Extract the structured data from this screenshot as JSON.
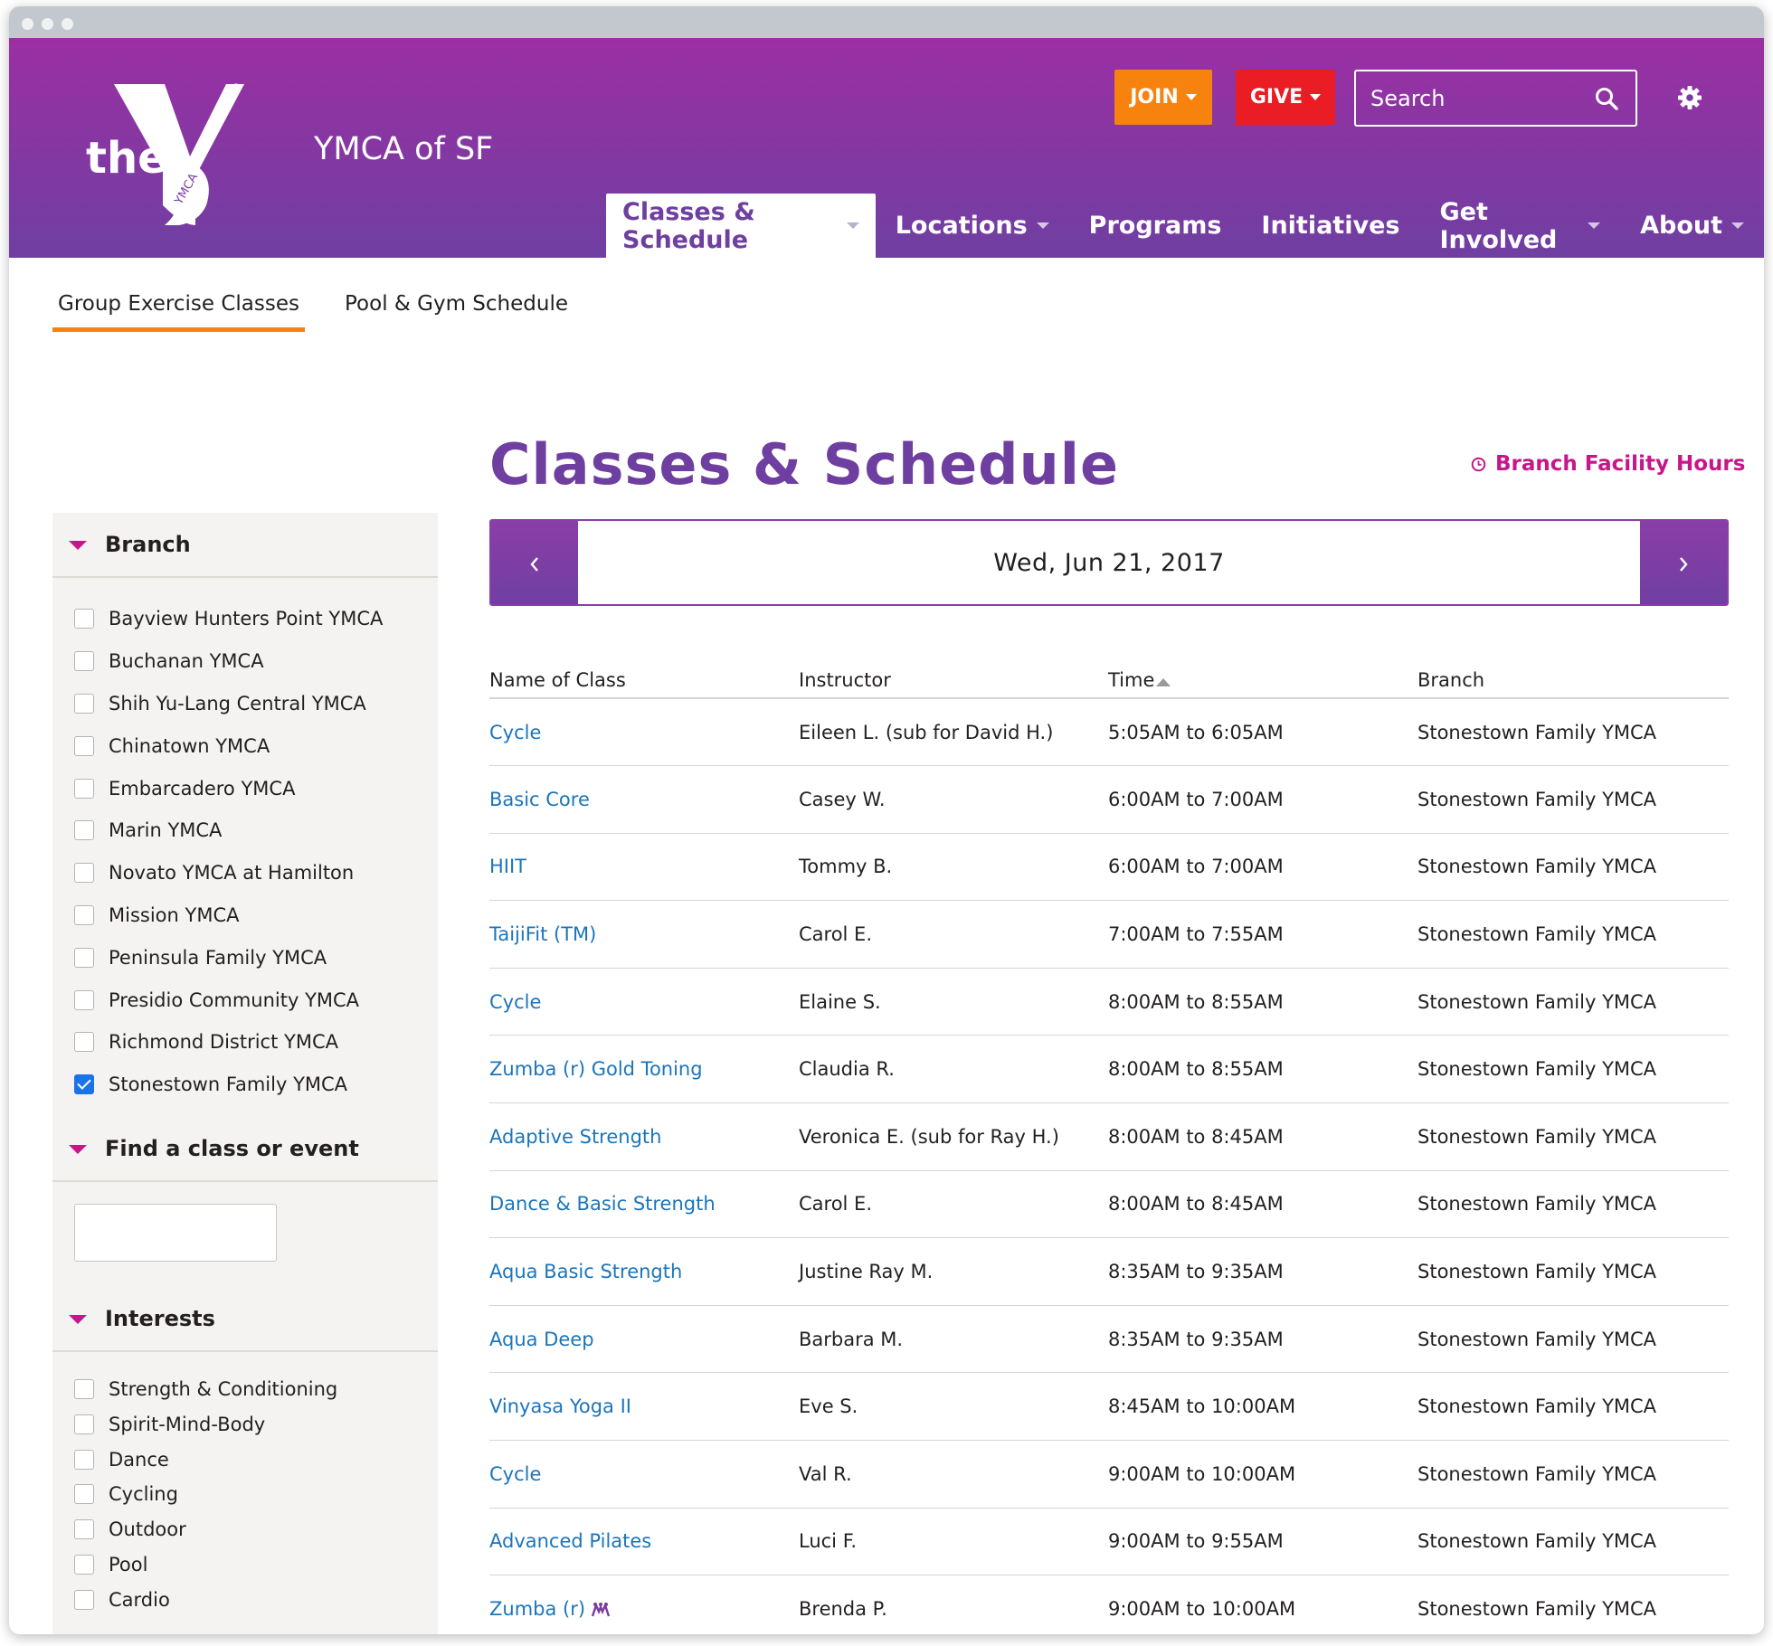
{
  "header": {
    "logo_text": "the",
    "logo_mark": "YMCA",
    "site_name": "YMCA of SF",
    "join_label": "JOIN",
    "give_label": "GIVE",
    "search_placeholder": "Search",
    "brand_gradient": [
      "#9b2fa3",
      "#6f3fa2"
    ],
    "join_color": "#f7820e",
    "give_color": "#ea1c24"
  },
  "nav": [
    {
      "label": "Classes & Schedule",
      "active": true,
      "dropdown": true
    },
    {
      "label": "Locations",
      "dropdown": true
    },
    {
      "label": "Programs",
      "dropdown": false
    },
    {
      "label": "Initiatives",
      "dropdown": false
    },
    {
      "label": "Get Involved",
      "dropdown": true
    },
    {
      "label": "About",
      "dropdown": true
    }
  ],
  "subnav": {
    "tabs": [
      "Group Exercise Classes",
      "Pool & Gym Schedule"
    ],
    "active": "Group Exercise Classes"
  },
  "page": {
    "title": "Classes & Schedule",
    "facility_link": "Branch Facility Hours",
    "date": "Wed, Jun 21, 2017"
  },
  "filters": {
    "branch": {
      "heading": "Branch",
      "items": [
        {
          "label": "Bayview Hunters Point YMCA",
          "checked": false
        },
        {
          "label": "Buchanan YMCA",
          "checked": false
        },
        {
          "label": "Shih Yu-Lang Central YMCA",
          "checked": false
        },
        {
          "label": "Chinatown YMCA",
          "checked": false
        },
        {
          "label": "Embarcadero YMCA",
          "checked": false
        },
        {
          "label": "Marin YMCA",
          "checked": false
        },
        {
          "label": "Novato YMCA at Hamilton",
          "checked": false
        },
        {
          "label": "Mission YMCA",
          "checked": false
        },
        {
          "label": "Peninsula Family YMCA",
          "checked": false
        },
        {
          "label": "Presidio Community YMCA",
          "checked": false
        },
        {
          "label": "Richmond District YMCA",
          "checked": false
        },
        {
          "label": "Stonestown Family YMCA",
          "checked": true
        }
      ]
    },
    "find": {
      "heading": "Find a class or event",
      "value": ""
    },
    "interests": {
      "heading": "Interests",
      "items": [
        {
          "label": "Strength & Conditioning",
          "checked": false
        },
        {
          "label": "Spirit-Mind-Body",
          "checked": false
        },
        {
          "label": "Dance",
          "checked": false
        },
        {
          "label": "Cycling",
          "checked": false
        },
        {
          "label": "Outdoor",
          "checked": false
        },
        {
          "label": "Pool",
          "checked": false
        },
        {
          "label": "Cardio",
          "checked": false
        }
      ]
    }
  },
  "table": {
    "columns": [
      "Name of Class",
      "Instructor",
      "Time",
      "Branch"
    ],
    "sorted_by": "Time",
    "rows": [
      {
        "name": "Cycle",
        "instructor": "Eileen L. (sub for David H.)",
        "time": "5:05AM to 6:05AM",
        "branch": "Stonestown Family YMCA"
      },
      {
        "name": "Basic Core",
        "instructor": "Casey W.",
        "time": "6:00AM to 7:00AM",
        "branch": "Stonestown Family YMCA"
      },
      {
        "name": "HIIT",
        "instructor": "Tommy B.",
        "time": "6:00AM to 7:00AM",
        "branch": "Stonestown Family YMCA"
      },
      {
        "name": "TaijiFit (TM)",
        "instructor": "Carol E.",
        "time": "7:00AM to 7:55AM",
        "branch": "Stonestown Family YMCA"
      },
      {
        "name": "Cycle",
        "instructor": "Elaine S.",
        "time": "8:00AM to 8:55AM",
        "branch": "Stonestown Family YMCA"
      },
      {
        "name": "Zumba (r) Gold Toning",
        "instructor": "Claudia R.",
        "time": "8:00AM to 8:55AM",
        "branch": "Stonestown Family YMCA"
      },
      {
        "name": "Adaptive Strength",
        "instructor": "Veronica E. (sub for Ray H.)",
        "time": "8:00AM to 8:45AM",
        "branch": "Stonestown Family YMCA"
      },
      {
        "name": "Dance & Basic Strength",
        "instructor": "Carol E.",
        "time": "8:00AM to 8:45AM",
        "branch": "Stonestown Family YMCA"
      },
      {
        "name": "Aqua Basic Strength",
        "instructor": "Justine Ray M.",
        "time": "8:35AM to 9:35AM",
        "branch": "Stonestown Family YMCA"
      },
      {
        "name": "Aqua Deep",
        "instructor": "Barbara M.",
        "time": "8:35AM to 9:35AM",
        "branch": "Stonestown Family YMCA"
      },
      {
        "name": "Vinyasa Yoga II",
        "instructor": "Eve S.",
        "time": "8:45AM to 10:00AM",
        "branch": "Stonestown Family YMCA"
      },
      {
        "name": "Cycle",
        "instructor": "Val R.",
        "time": "9:00AM to 10:00AM",
        "branch": "Stonestown Family YMCA"
      },
      {
        "name": "Advanced Pilates",
        "instructor": "Luci F.",
        "time": "9:00AM to 9:55AM",
        "branch": "Stonestown Family YMCA"
      },
      {
        "name": "Zumba (r)",
        "instructor": "Brenda P.",
        "time": "9:00AM to 10:00AM",
        "branch": "Stonestown Family YMCA",
        "icon": "group-icon"
      }
    ]
  }
}
